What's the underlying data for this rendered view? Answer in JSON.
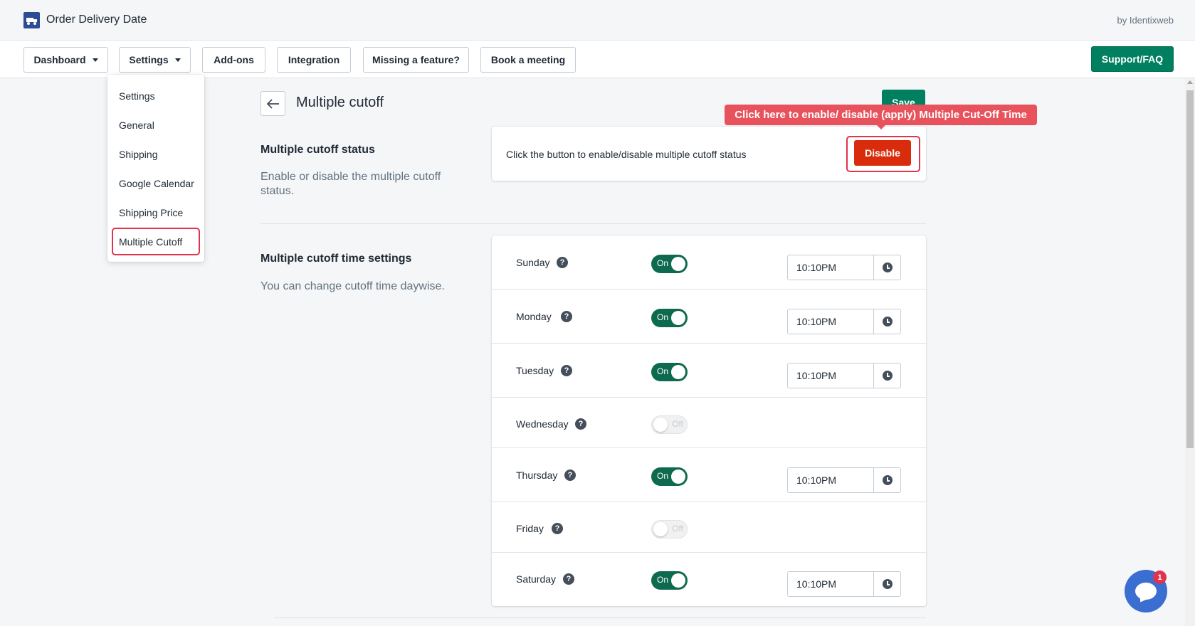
{
  "app": {
    "title": "Order Delivery Date",
    "by_line": "by Identixweb"
  },
  "nav": {
    "dashboard": "Dashboard",
    "settings": "Settings",
    "addons": "Add-ons",
    "integration": "Integration",
    "missing_feature": "Missing a feature?",
    "book_meeting": "Book a meeting",
    "support": "Support/FAQ"
  },
  "settings_menu": {
    "items": [
      "Settings",
      "General",
      "Shipping",
      "Google Calendar",
      "Shipping Price",
      "Multiple Cutoff"
    ],
    "active": "Multiple Cutoff"
  },
  "page": {
    "title": "Multiple cutoff",
    "save_label": "Save",
    "tooltip": "Click here to enable/ disable (apply) Multiple Cut-Off Time"
  },
  "status_section": {
    "title": "Multiple cutoff status",
    "description": "Enable or disable the multiple cutoff status.",
    "card_text": "Click the button to enable/disable multiple cutoff status",
    "button_label": "Disable"
  },
  "time_section": {
    "title": "Multiple cutoff time settings",
    "description": "You can change cutoff time daywise.",
    "help_glyph": "?",
    "days": [
      {
        "day": "Sunday",
        "toggle": "On",
        "enabled": true,
        "time": "10:10PM"
      },
      {
        "day": "Monday",
        "toggle": "On",
        "enabled": true,
        "time": "10:10PM"
      },
      {
        "day": "Tuesday",
        "toggle": "On",
        "enabled": true,
        "time": "10:10PM"
      },
      {
        "day": "Wednesday",
        "toggle": "Off",
        "enabled": false,
        "time": ""
      },
      {
        "day": "Thursday",
        "toggle": "On",
        "enabled": true,
        "time": "10:10PM"
      },
      {
        "day": "Friday",
        "toggle": "Off",
        "enabled": false,
        "time": ""
      },
      {
        "day": "Saturday",
        "toggle": "On",
        "enabled": true,
        "time": "10:10PM"
      }
    ]
  },
  "chat": {
    "badge_count": "1"
  },
  "colors": {
    "primary_green": "#008060",
    "toggle_on": "#0e6a4e",
    "destructive": "#d82c0d",
    "highlight": "#e0334d",
    "tooltip_bg": "#e8525d",
    "chat_blue": "#3b6ed1"
  }
}
